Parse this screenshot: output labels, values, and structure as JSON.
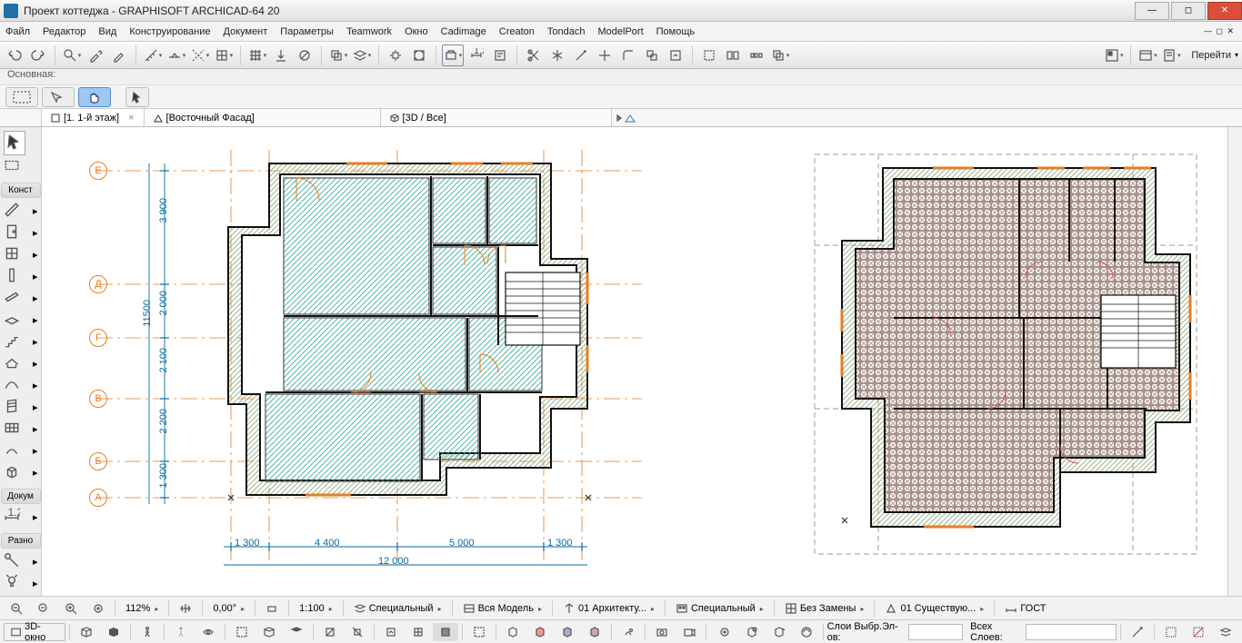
{
  "window": {
    "title": "Проект коттеджа - GRAPHISOFT ARCHICAD-64 20"
  },
  "menu": {
    "items": [
      "Файл",
      "Редактор",
      "Вид",
      "Конструирование",
      "Документ",
      "Параметры",
      "Teamwork",
      "Окно",
      "Cadimage",
      "Creaton",
      "Tondach",
      "ModelPort",
      "Помощь"
    ],
    "sub_controls": "— ◻ ✕"
  },
  "toolbar": {
    "go_label": "Перейти"
  },
  "strip2": {
    "label": "Основная:"
  },
  "tabs": {
    "t1": "[1. 1-й этаж]",
    "t2": "[Восточный Фасад]",
    "t3": "[3D / Все]"
  },
  "toolbox": {
    "group1": "Конст",
    "group2": "Докум",
    "group3": "Разно"
  },
  "plan": {
    "axes_v": [
      "Е",
      "Д",
      "Г",
      "В",
      "Б",
      "А"
    ],
    "dims_v": [
      "3 900",
      "2 000",
      "2 100",
      "2 200",
      "1 300"
    ],
    "overall_v": "11500",
    "dims_h": [
      "1 300",
      "4 400",
      "5 000",
      "1 300"
    ],
    "overall_h": "12 000"
  },
  "status": {
    "zoom": "112%",
    "angle": "0,00°",
    "scale": "1:100",
    "d1": "Специальный",
    "d2": "Вся Модель",
    "d3": "01 Архитекту...",
    "d4": "Специальный",
    "d5": "Без Замены",
    "d6": "01 Существую...",
    "d7": "ГОСТ",
    "view3d": "3D-окно",
    "layers_sel": "Слои Выбр.Эл-ов:",
    "layers_all": "Всех Слоев:"
  }
}
